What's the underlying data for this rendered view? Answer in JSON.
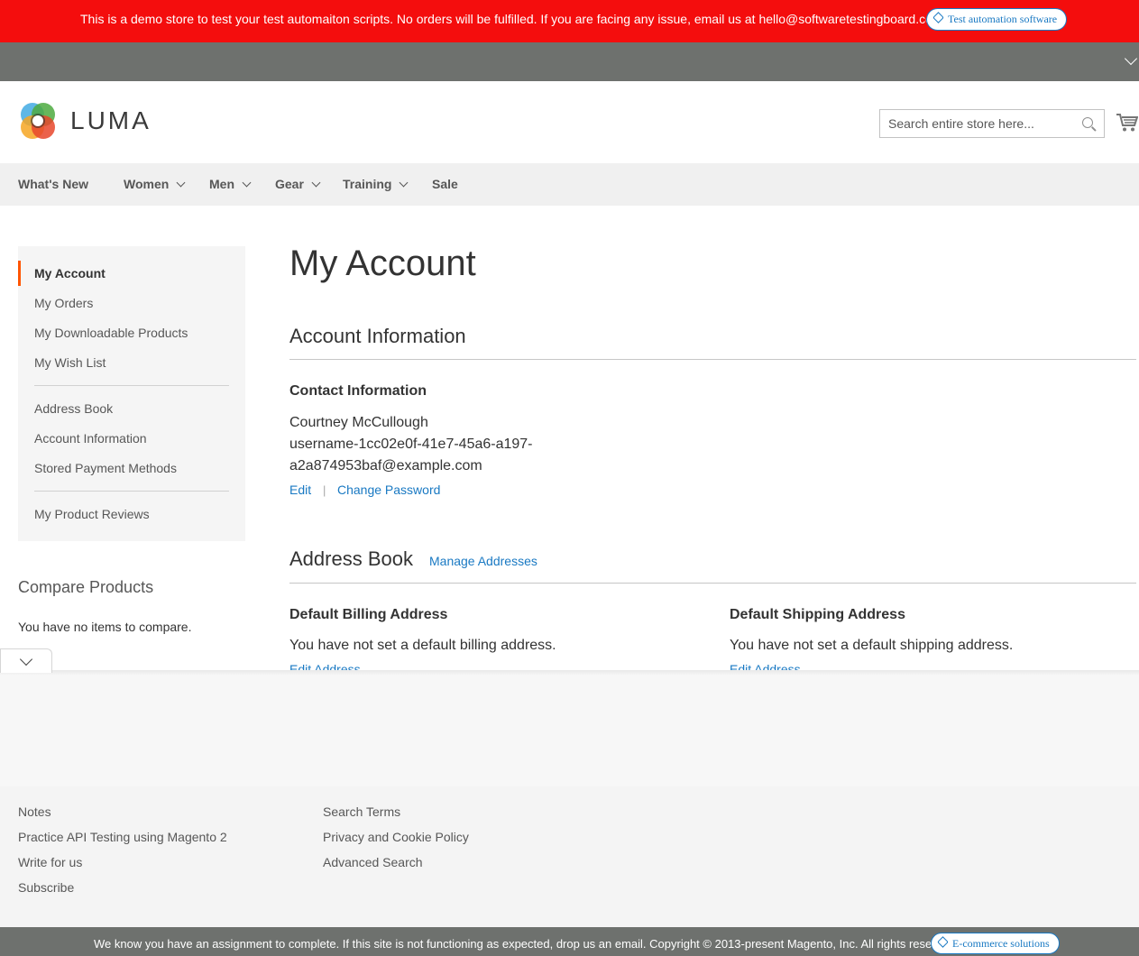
{
  "demo_banner": {
    "message": "This is a demo store to test your test automaiton scripts. No orders will be fulfilled. If you are facing any issue, email us at hello@softwaretestingboard.com.",
    "badge": "Test automation software"
  },
  "header": {
    "logo_text": "LUMA",
    "search_placeholder": "Search entire store here...",
    "cart_icon": "shopping-cart-icon"
  },
  "nav": {
    "items": [
      {
        "label": "What's New",
        "has_dropdown": false
      },
      {
        "label": "Women",
        "has_dropdown": true
      },
      {
        "label": "Men",
        "has_dropdown": true
      },
      {
        "label": "Gear",
        "has_dropdown": true
      },
      {
        "label": "Training",
        "has_dropdown": true
      },
      {
        "label": "Sale",
        "has_dropdown": false
      }
    ]
  },
  "sidebar": {
    "items": [
      {
        "label": "My Account",
        "current": true
      },
      {
        "label": "My Orders"
      },
      {
        "label": "My Downloadable Products"
      },
      {
        "label": "My Wish List"
      },
      {
        "label": "Address Book"
      },
      {
        "label": "Account Information"
      },
      {
        "label": "Stored Payment Methods"
      },
      {
        "label": "My Product Reviews"
      }
    ],
    "accent_color": "#ff5501"
  },
  "compare": {
    "title": "Compare Products",
    "empty_text": "You have no items to compare."
  },
  "main": {
    "title": "My Account",
    "account_info": {
      "title": "Account Information",
      "contact_title": "Contact Information",
      "name": "Courtney McCullough",
      "email_line1": "username-1cc02e0f-41e7-45a6-a197-",
      "email_line2": "a2a874953baf@example.com",
      "edit_label": "Edit",
      "separator": "|",
      "change_password_label": "Change Password"
    },
    "address_book": {
      "title": "Address Book",
      "manage_label": "Manage Addresses",
      "billing_title": "Default Billing Address",
      "billing_text": "You have not set a default billing address.",
      "billing_edit": "Edit Address",
      "shipping_title": "Default Shipping Address",
      "shipping_text": "You have not set a default shipping address.",
      "shipping_edit": "Edit Address"
    }
  },
  "footer": {
    "col1": [
      "Notes",
      "Practice API Testing using Magento 2",
      "Write for us",
      "Subscribe"
    ],
    "col2": [
      "Search Terms",
      "Privacy and Cookie Policy",
      "Advanced Search"
    ]
  },
  "bottom_bar": {
    "message": "We know you have an assignment to complete. If this site is not functioning as expected, drop us an email. Copyright © 2013-present Magento, Inc. All rights reserved.",
    "badge": "E-commerce solutions"
  },
  "colors": {
    "banner_red": "#f40d0d",
    "link_blue": "#1979c3",
    "gray_bar": "#6e716e"
  }
}
